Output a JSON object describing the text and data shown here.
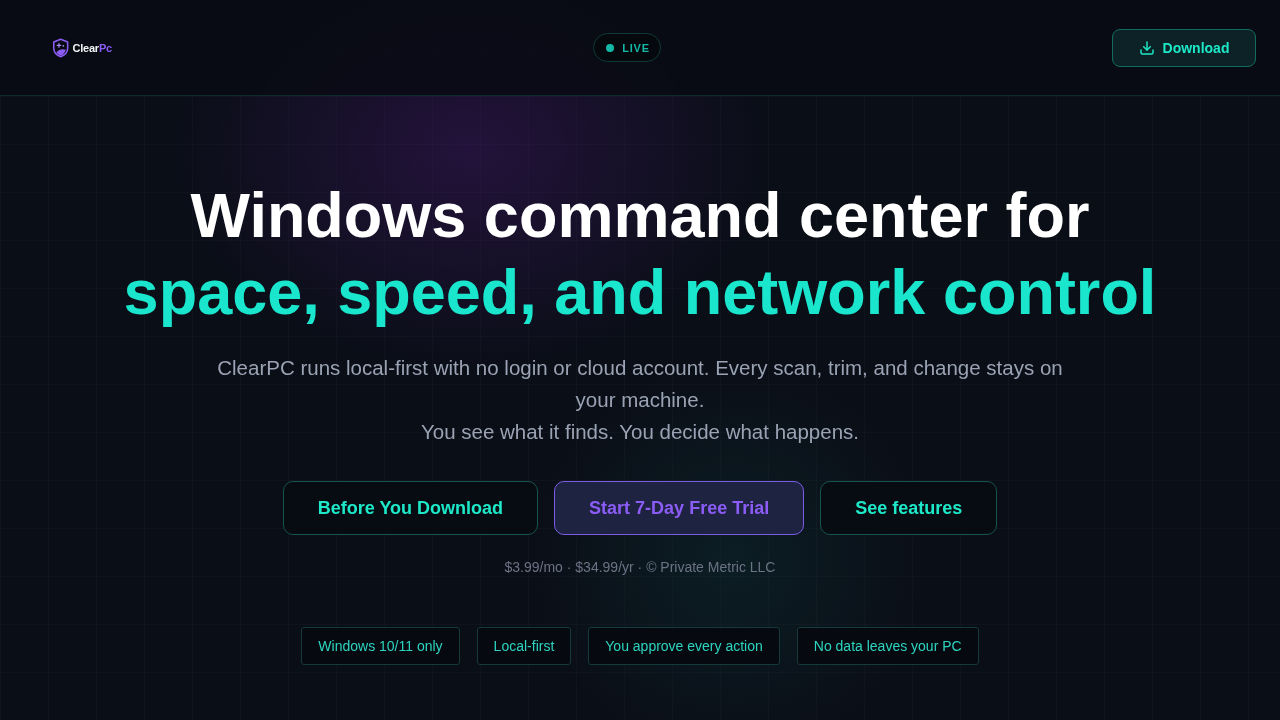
{
  "header": {
    "logo": {
      "name": "Clear",
      "accent": "Pc"
    },
    "status": {
      "label": "LIVE"
    },
    "download_button": {
      "label": "Download"
    }
  },
  "hero": {
    "title": "Windows command center for",
    "title_highlight": "space, speed, and network control",
    "description": [
      "ClearPC runs local-first with no login or cloud account. Every scan, trim, and change stays on your machine.",
      "You see what it finds. You decide what happens."
    ],
    "actions": [
      {
        "label": "Before You Download",
        "kind": "outline"
      },
      {
        "label": "Start 7-Day Free Trial",
        "kind": "primary"
      },
      {
        "label": "See features",
        "kind": "outline"
      }
    ],
    "pricing": "$3.99/mo · $34.99/yr · © Private Metric LLC",
    "tags": [
      "Windows 10/11 only",
      "Local-first",
      "You approve every action",
      "No data leaves your PC"
    ]
  }
}
